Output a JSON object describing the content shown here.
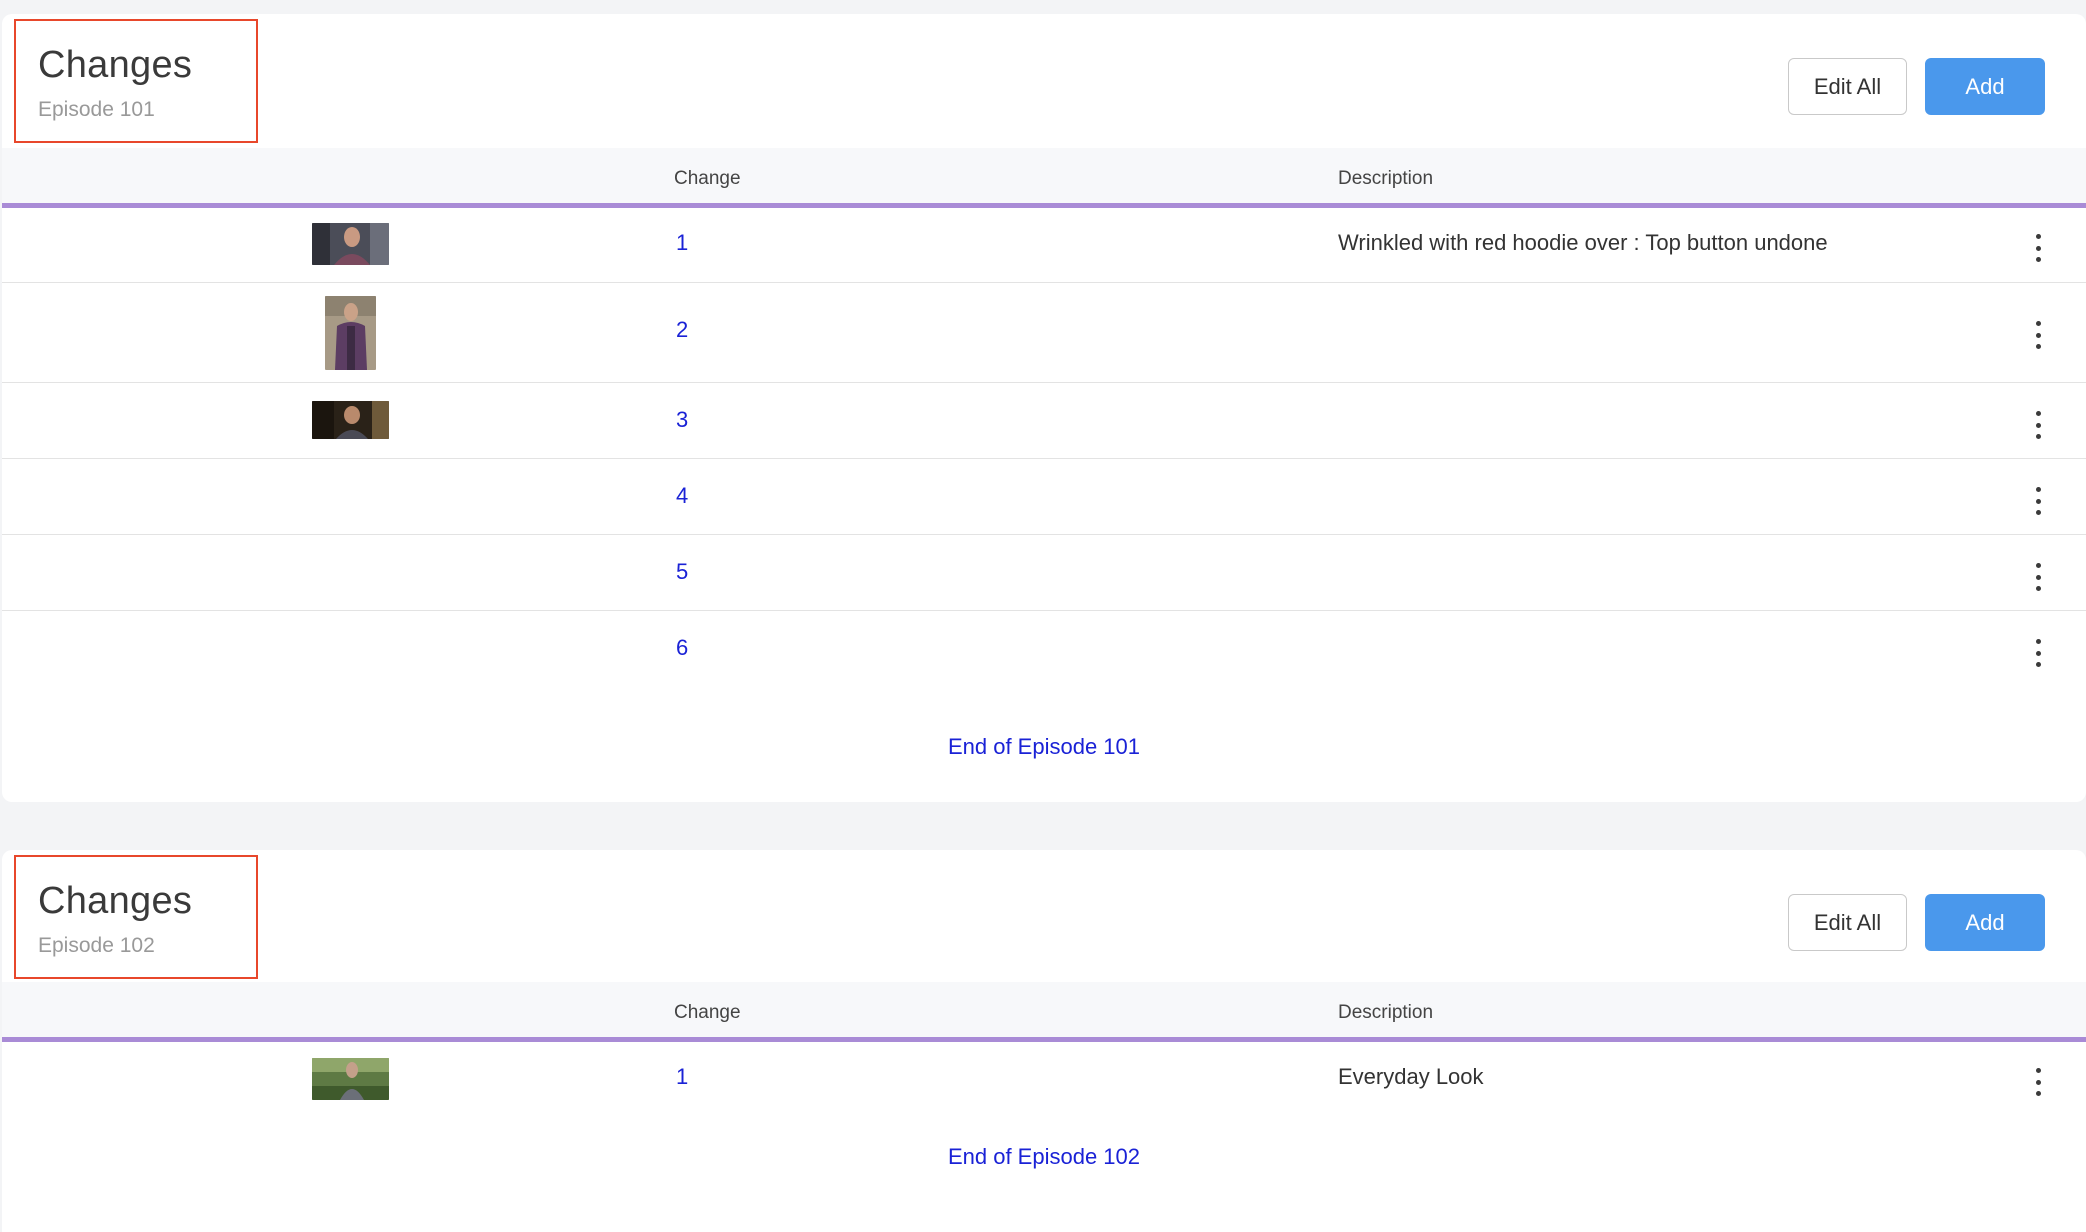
{
  "sections": [
    {
      "title": "Changes",
      "episode": "Episode 101",
      "edit_all_label": "Edit All",
      "add_label": "Add",
      "columns": {
        "change": "Change",
        "description": "Description"
      },
      "rows": [
        {
          "change": "1",
          "description": "Wrinkled with red hoodie over : Top button undone",
          "thumbnail": "wide"
        },
        {
          "change": "2",
          "description": "",
          "thumbnail": "tall"
        },
        {
          "change": "3",
          "description": "",
          "thumbnail": "wide"
        },
        {
          "change": "4",
          "description": "",
          "thumbnail": "none"
        },
        {
          "change": "5",
          "description": "",
          "thumbnail": "none"
        },
        {
          "change": "6",
          "description": "",
          "thumbnail": "none"
        }
      ],
      "end_label": "End of Episode 101"
    },
    {
      "title": "Changes",
      "episode": "Episode 102",
      "edit_all_label": "Edit All",
      "add_label": "Add",
      "columns": {
        "change": "Change",
        "description": "Description"
      },
      "rows": [
        {
          "change": "1",
          "description": "Everyday Look",
          "thumbnail": "wide"
        }
      ],
      "end_label": "End of Episode 102"
    }
  ],
  "colors": {
    "accent": "#4a98ec",
    "link": "#1a22d6",
    "header_divider": "#a98bd6",
    "highlight_box": "#e8472b"
  },
  "icons": {
    "row_menu": "more-vertical-icon"
  }
}
